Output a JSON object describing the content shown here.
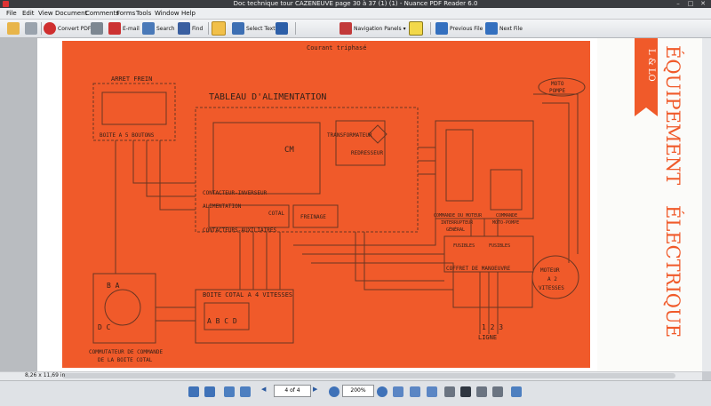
{
  "window": {
    "title": "Doc technique tour CAZENEUVE page 30 à 37 (1) (1) - Nuance PDF Reader 6.0"
  },
  "menu": [
    "File",
    "Edit",
    "View",
    "Document",
    "Comments",
    "Forms",
    "Tools",
    "Window",
    "Help"
  ],
  "toolbar": {
    "convert_pdf": "Convert PDF",
    "email": "E-mail",
    "search": "Search",
    "find": "Find",
    "select_text": "Select Text",
    "navigation_panels": "Navigation Panels",
    "previous_file": "Previous File",
    "next_file": "Next File"
  },
  "document": {
    "header": "Courant triphasé",
    "labels": {
      "arret_frein": "ARRET FREIN",
      "boite_boutons": "BOITE A 5 BOUTONS",
      "tableau": "TABLEAU D'ALIMENTATION",
      "transformateur": "TRANSFORMATEUR",
      "redresseur": "REDRESSEUR",
      "cm": "CM",
      "contacteur_inverseur": "CONTACTEUR-INVERSEUR",
      "alimentation": "ALIMENTATION",
      "cotal": "COTAL",
      "freinage": "FREINAGE",
      "contacteurs_aux": "CONTACTEURS-AUXILIAIRES",
      "commande_moteur": "COMMANDE DU MOTEUR",
      "interrupteur": "INTERRUPTEUR",
      "general": "GÉNÉRAL",
      "commande_moto": "COMMANDE",
      "moto_pompe_small": "MOTO-POMPE",
      "moto_pompe": "MOTO",
      "pompe": "POMPE",
      "fusibles": "FUSIBLES",
      "fusibles2": "FUSIBLES",
      "coffret": "COFFRET DE MANOEUVRE",
      "moteur": "MOTEUR",
      "a2": "A 2",
      "vitesses": "VITESSES",
      "boite_cotal": "BOITE COTAL A 4 VITESSES",
      "ligne_num": "1 2 3",
      "ligne": "LIGNE",
      "commutateur": "COMMUTATEUR DE COMMANDE",
      "de_la_boite": "DE LA BOITE COTAL",
      "ba": "B A",
      "dc": "D C",
      "abcd": "A B C D"
    },
    "right_page": {
      "tag": "L & LO",
      "heading1": "ÉQUIPEMENT",
      "heading2": "ÉLECTRIQUE"
    }
  },
  "status": {
    "page_size": "8,26 x 11,69 in",
    "page_indicator": "4 of 4",
    "zoom": "200%"
  }
}
